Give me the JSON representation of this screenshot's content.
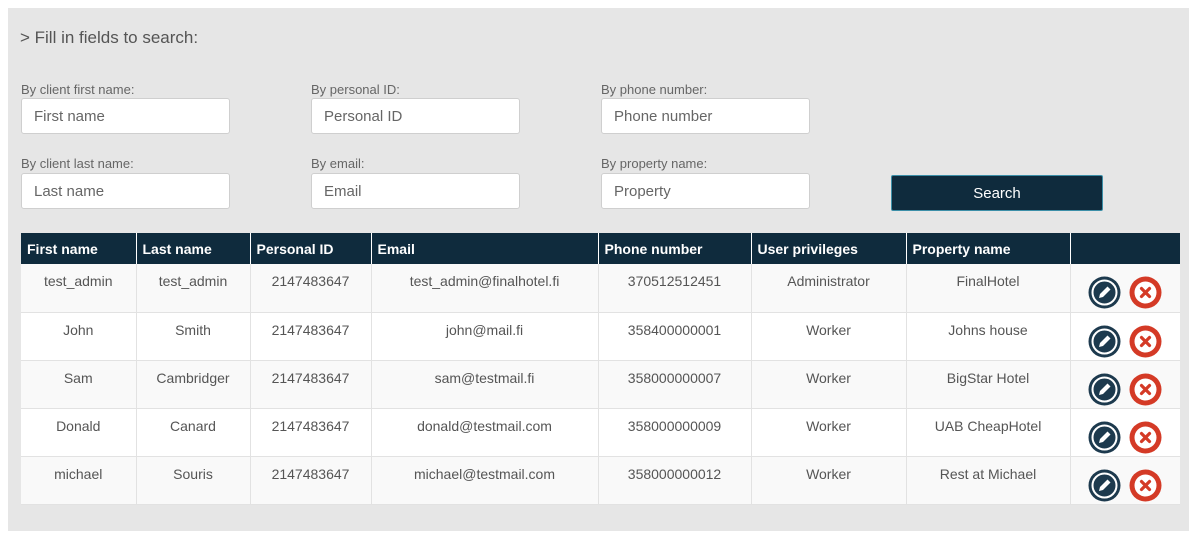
{
  "search": {
    "heading": "> Fill in fields to search:",
    "first_name": {
      "label": "By client first name:",
      "placeholder": "First name"
    },
    "personal_id": {
      "label": "By personal ID:",
      "placeholder": "Personal ID"
    },
    "phone": {
      "label": "By phone number:",
      "placeholder": "Phone number"
    },
    "last_name": {
      "label": "By client last name:",
      "placeholder": "Last name"
    },
    "email": {
      "label": "By email:",
      "placeholder": "Email"
    },
    "property": {
      "label": "By property name:",
      "placeholder": "Property"
    },
    "button_label": "Search"
  },
  "table": {
    "headers": [
      "First name",
      "Last name",
      "Personal ID",
      "Email",
      "Phone number",
      "User privileges",
      "Property name",
      ""
    ],
    "rows": [
      [
        "test_admin",
        "test_admin",
        "2147483647",
        "test_admin@finalhotel.fi",
        "370512512451",
        "Administrator",
        "FinalHotel"
      ],
      [
        "John",
        "Smith",
        "2147483647",
        "john@mail.fi",
        "358400000001",
        "Worker",
        "Johns house"
      ],
      [
        "Sam",
        "Cambridger",
        "2147483647",
        "sam@testmail.fi",
        "358000000007",
        "Worker",
        "BigStar Hotel"
      ],
      [
        "Donald",
        "Canard",
        "2147483647",
        "donald@testmail.com",
        "358000000009",
        "Worker",
        "UAB CheapHotel"
      ],
      [
        "michael",
        "Souris",
        "2147483647",
        "michael@testmail.com",
        "358000000012",
        "Worker",
        "Rest at Michael"
      ]
    ]
  },
  "icons": {
    "edit": "pencil-icon",
    "delete": "close-x-icon"
  },
  "colors": {
    "header_bg": "#0f2b3d",
    "edit_btn": "#1d3a4e",
    "delete_btn": "#d43a26",
    "panel_bg": "#e6e6e6"
  }
}
